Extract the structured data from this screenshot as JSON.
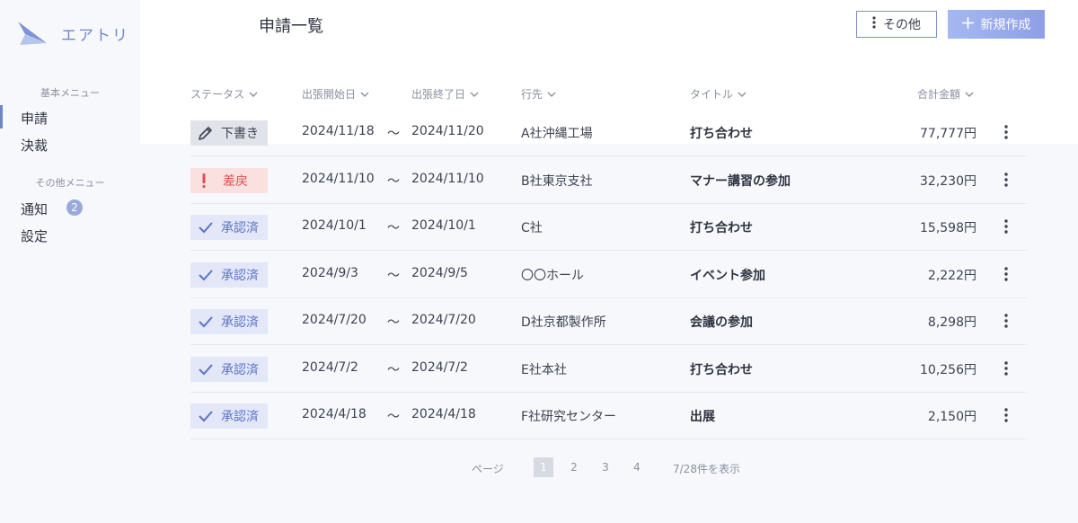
{
  "app": {
    "logo_text": "エアトリ"
  },
  "sidebar": {
    "section_basic": "基本メニュー",
    "items_basic": [
      {
        "label": "申請"
      },
      {
        "label": "決裁"
      }
    ],
    "section_other": "その他メニュー",
    "items_other": [
      {
        "label": "通知",
        "badge": "2"
      },
      {
        "label": "設定"
      }
    ]
  },
  "header": {
    "title": "申請一覧",
    "other_label": "その他",
    "new_label": "新規作成"
  },
  "table": {
    "columns": [
      "ステータス",
      "出張開始日",
      "出張終了日",
      "行先",
      "タイトル",
      "合計金額"
    ],
    "separator": "〜",
    "rows": [
      {
        "status": "下書き",
        "status_type": "draft",
        "start": "2024/11/18",
        "end": "2024/11/20",
        "dest": "A社沖縄工場",
        "title": "打ち合わせ",
        "amount": "77,777円"
      },
      {
        "status": "差戻",
        "status_type": "returned",
        "start": "2024/11/10",
        "end": "2024/11/10",
        "dest": "B社東京支社",
        "title": "マナー講習の参加",
        "amount": "32,230円"
      },
      {
        "status": "承認済",
        "status_type": "approved",
        "start": "2024/10/1",
        "end": "2024/10/1",
        "dest": "C社",
        "title": "打ち合わせ",
        "amount": "15,598円"
      },
      {
        "status": "承認済",
        "status_type": "approved",
        "start": "2024/9/3",
        "end": "2024/9/5",
        "dest": "〇〇ホール",
        "title": "イベント参加",
        "amount": "2,222円"
      },
      {
        "status": "承認済",
        "status_type": "approved",
        "start": "2024/7/20",
        "end": "2024/7/20",
        "dest": "D社京都製作所",
        "title": "会議の参加",
        "amount": "8,298円"
      },
      {
        "status": "承認済",
        "status_type": "approved",
        "start": "2024/7/2",
        "end": "2024/7/2",
        "dest": "E社本社",
        "title": "打ち合わせ",
        "amount": "10,256円"
      },
      {
        "status": "承認済",
        "status_type": "approved",
        "start": "2024/4/18",
        "end": "2024/4/18",
        "dest": "F社研究センター",
        "title": "出展",
        "amount": "2,150円"
      }
    ]
  },
  "pagination": {
    "label": "ページ",
    "pages": [
      "1",
      "2",
      "3",
      "4"
    ],
    "current": "1",
    "summary": "7/28件を表示"
  },
  "colors": {
    "accent": "#6f86c9",
    "draft_bg": "#e1e3ea",
    "returned_bg": "#fbe0e0",
    "returned_fg": "#e04f4f",
    "approved_bg": "#e3e7f7",
    "approved_fg": "#5b73c6"
  },
  "icons": {
    "logo": "paper-plane-icon",
    "sort": "chevron-down-icon",
    "draft": "pencil-icon",
    "returned": "exclamation-icon",
    "approved": "check-icon",
    "row_menu": "kebab-menu-icon",
    "other": "vertical-dots-icon",
    "new": "plus-icon"
  }
}
